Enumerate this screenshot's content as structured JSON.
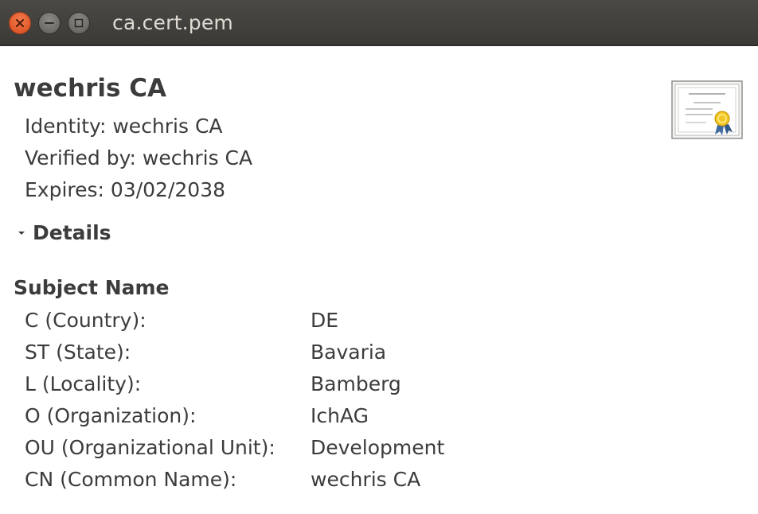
{
  "window": {
    "title": "ca.cert.pem"
  },
  "certificate": {
    "name": "wechris CA",
    "identity": "Identity: wechris CA",
    "verified_by": "Verified by: wechris CA",
    "expires": "Expires: 03/02/2038",
    "icon": "certificate-icon"
  },
  "details": {
    "label": "Details",
    "expanded": true
  },
  "subject_name": {
    "title": "Subject Name",
    "fields": [
      {
        "label": "C (Country):",
        "value": "DE"
      },
      {
        "label": "ST (State):",
        "value": "Bavaria"
      },
      {
        "label": "L (Locality):",
        "value": "Bamberg"
      },
      {
        "label": "O (Organization):",
        "value": "IchAG"
      },
      {
        "label": "OU (Organizational Unit):",
        "value": "Development"
      },
      {
        "label": "CN (Common Name):",
        "value": "wechris CA"
      }
    ]
  },
  "colors": {
    "titlebar": "#3b3a36",
    "close_button": "#e0592a",
    "text": "#3c3c3c"
  }
}
